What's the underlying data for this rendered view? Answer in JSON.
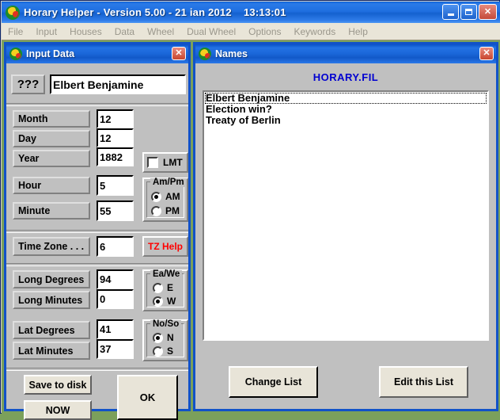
{
  "app": {
    "icon": "astrology-app-icon",
    "title": "Horary Helper - Version 5.00 - 21 ian 2012    13:13:01",
    "window_buttons": {
      "minimize": "minimize-button",
      "maximize": "maximize-button",
      "close_label": "✕"
    },
    "menu": [
      {
        "label": "File"
      },
      {
        "label": "Input"
      },
      {
        "label": "Houses"
      },
      {
        "label": "Data"
      },
      {
        "label": "Wheel"
      },
      {
        "label": "Dual Wheel"
      },
      {
        "label": "Options"
      },
      {
        "label": "Keywords"
      },
      {
        "label": "Help"
      }
    ]
  },
  "input_dialog": {
    "title": "Input Data",
    "icon": "astrology-app-icon",
    "close_label": "✕",
    "name_button_label": "???",
    "name_value": "Elbert Benjamine",
    "fields": [
      {
        "label": "Month",
        "value": "12"
      },
      {
        "label": "Day",
        "value": "12"
      },
      {
        "label": "Year",
        "value": "1882"
      },
      {
        "label": "Hour",
        "value": "5"
      },
      {
        "label": "Minute",
        "value": "55"
      },
      {
        "label": "Time Zone . . .",
        "value": "6"
      },
      {
        "label": "Long Degrees",
        "value": "94"
      },
      {
        "label": "Long Minutes",
        "value": "0"
      },
      {
        "label": "Lat Degrees",
        "value": "41"
      },
      {
        "label": "Lat Minutes",
        "value": "37"
      }
    ],
    "lmt": {
      "label": "LMT",
      "checked": false
    },
    "tz_help": {
      "label": "TZ Help",
      "color": "#ff0000"
    },
    "ampm_group": {
      "legend": "Am/Pm",
      "options": [
        {
          "label": "AM",
          "selected": true
        },
        {
          "label": "PM",
          "selected": false
        }
      ]
    },
    "eawe_group": {
      "legend": "Ea/We",
      "options": [
        {
          "label": "E",
          "selected": false
        },
        {
          "label": "W",
          "selected": true
        }
      ]
    },
    "noso_group": {
      "legend": "No/So",
      "options": [
        {
          "label": "N",
          "selected": true
        },
        {
          "label": "S",
          "selected": false
        }
      ]
    },
    "buttons": {
      "save_to_disk": "Save to disk",
      "now": "NOW",
      "ok": "OK"
    }
  },
  "names_dialog": {
    "title": "Names",
    "icon": "astrology-app-icon",
    "close_label": "✕",
    "filename": "HORARY.FIL",
    "list_items": [
      {
        "label": "Elbert Benjamine",
        "focused": true
      },
      {
        "label": "Election win?",
        "focused": false
      },
      {
        "label": "Treaty of Berlin",
        "focused": false
      }
    ],
    "buttons": {
      "change_list": "Change List",
      "edit_this_list": "Edit this List"
    }
  },
  "colors": {
    "titlebar_blue": "#1a66d8",
    "dialog_face": "#c0c0c0",
    "desktop_green": "#7ba05b",
    "menubar": "#e9e5d8",
    "accent_red": "#ff0000",
    "accent_blue_text": "#0000d0"
  }
}
